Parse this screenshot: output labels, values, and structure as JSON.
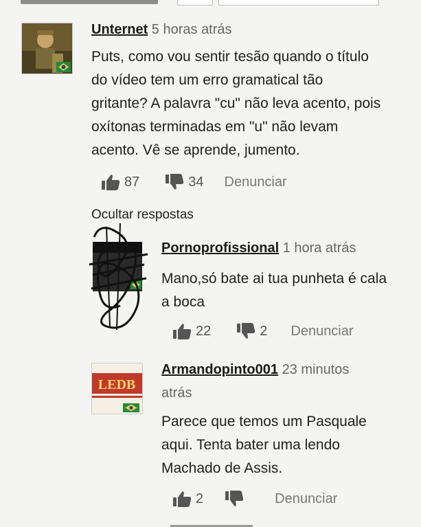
{
  "hide_replies_label": "Ocultar respostas",
  "comments": [
    {
      "user": "Unternet",
      "time": "5 horas atrás",
      "text_lines": [
        "Puts, como vou sentir tesão quando o título",
        "do vídeo tem um erro gramatical tão",
        "gritante? A palavra \"cu\" não leva acento, pois",
        "oxítonas terminadas em \"u\" não levam",
        "acento. Vê se aprende, jumento."
      ],
      "likes": "87",
      "dislikes": "34",
      "report_label": "Denunciar"
    },
    {
      "user": "Pornoprofissional",
      "time": "1 hora atrás",
      "text_lines": [
        "Mano,só bate ai tua punheta é cala",
        "a boca"
      ],
      "likes": "22",
      "dislikes": "2",
      "report_label": "Denunciar"
    },
    {
      "user": "Armandopinto001",
      "time_line1": "23 minutos",
      "time_line2": "atrás",
      "text_lines": [
        "Parece que temos um Pasquale",
        "aqui. Tenta bater uma lendo",
        "Machado de Assis."
      ],
      "likes": "2",
      "report_label": "Denunciar"
    }
  ],
  "colors": {
    "background": "#f4f4f2",
    "flag_green": "#1f8a3a",
    "flag_yellow": "#f2c94c",
    "scribble": "#111111",
    "avatar3_red": "#c0392b"
  },
  "icons": [
    "thumbs-up-icon",
    "thumbs-down-icon",
    "brazil-flag-icon"
  ]
}
